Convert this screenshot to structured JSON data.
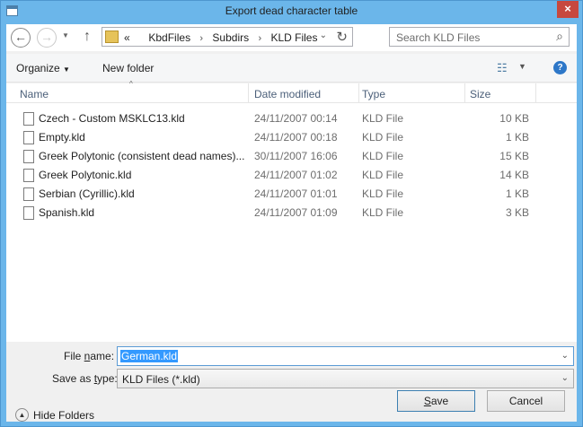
{
  "window": {
    "title": "Export dead character table",
    "close_symbol": "×"
  },
  "nav": {
    "back_symbol": "←",
    "forward_symbol": "→",
    "recent_symbol": "▼",
    "up_symbol": "↑",
    "breadcrumb_prefix": "«",
    "breadcrumb": [
      "KbdFiles",
      "Subdirs",
      "KLD Files"
    ],
    "breadcrumb_separator": "›",
    "address_dropdown_symbol": "⌄",
    "refresh_symbol": "↻",
    "search_placeholder": "Search KLD Files",
    "search_symbol": "⌕"
  },
  "toolbar": {
    "organize": "Organize",
    "organize_arrow": "▼",
    "new_folder": "New folder",
    "view_symbol": "☷",
    "view_arrow": "▼",
    "help_symbol": "?"
  },
  "columns": {
    "name": "Name",
    "date": "Date modified",
    "type": "Type",
    "size": "Size",
    "sort_symbol": "^"
  },
  "files": [
    {
      "name": "Czech - Custom MSKLC13.kld",
      "date": "24/11/2007 00:14",
      "type": "KLD File",
      "size": "10 KB"
    },
    {
      "name": "Empty.kld",
      "date": "24/11/2007 00:18",
      "type": "KLD File",
      "size": "1 KB"
    },
    {
      "name": "Greek Polytonic (consistent dead names)...",
      "date": "30/11/2007 16:06",
      "type": "KLD File",
      "size": "15 KB"
    },
    {
      "name": "Greek Polytonic.kld",
      "date": "24/11/2007 01:02",
      "type": "KLD File",
      "size": "14 KB"
    },
    {
      "name": "Serbian (Cyrillic).kld",
      "date": "24/11/2007 01:01",
      "type": "KLD File",
      "size": "1 KB"
    },
    {
      "name": "Spanish.kld",
      "date": "24/11/2007 01:09",
      "type": "KLD File",
      "size": "3 KB"
    }
  ],
  "form": {
    "filename_label_a": "File ",
    "filename_label_u": "n",
    "filename_label_b": "ame:",
    "filename_value": "German.kld",
    "savetype_label_a": "Save as ",
    "savetype_label_u": "t",
    "savetype_label_b": "ype:",
    "savetype_value": "KLD Files (*.kld)",
    "dropdown_symbol": "⌄",
    "hide_folders": "Hide Folders",
    "hide_symbol": "▲",
    "save_u": "S",
    "save_rest": "ave",
    "cancel": "Cancel"
  }
}
